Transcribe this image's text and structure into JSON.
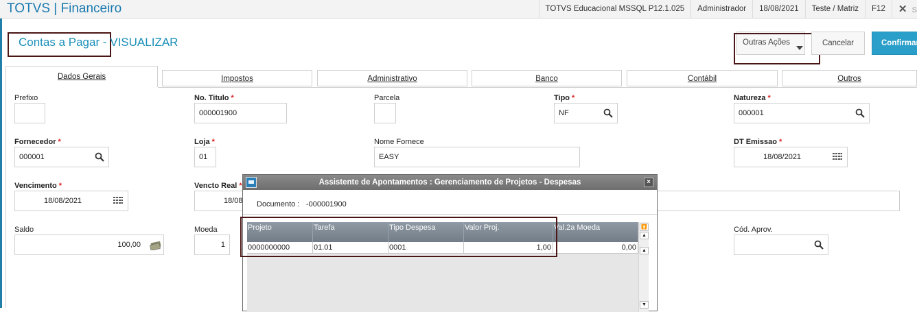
{
  "app": {
    "title": "TOTVS | Financeiro",
    "product": "TOTVS Educacional MSSQL P12.1.025",
    "user": "Administrador",
    "date": "18/08/2021",
    "company": "Teste / Matriz",
    "help_key": "F12",
    "exit_label": "S",
    "accent_color": "#1a7ab0"
  },
  "page": {
    "title": "Contas a Pagar",
    "separator": " - ",
    "mode": "VISUALIZAR"
  },
  "actions": {
    "other_actions": "Outras Ações",
    "cancel": "Cancelar",
    "confirm": "Confirmar"
  },
  "tabs": [
    "Dados Gerais",
    "Impostos",
    "Administrativo",
    "Banco",
    "Contábil",
    "Outros"
  ],
  "form": {
    "prefixo": {
      "label": "Prefixo",
      "value": ""
    },
    "no_titulo": {
      "label": "No. Titulo",
      "value": "000001900"
    },
    "parcela": {
      "label": "Parcela",
      "value": ""
    },
    "tipo": {
      "label": "Tipo",
      "value": "NF"
    },
    "natureza": {
      "label": "Natureza",
      "value": "000001"
    },
    "fornecedor": {
      "label": "Fornecedor",
      "value": "000001"
    },
    "loja": {
      "label": "Loja",
      "value": "01"
    },
    "nome_fornece": {
      "label": "Nome Fornece",
      "value": "EASY"
    },
    "dt_emissao": {
      "label": "DT Emissao",
      "value": "18/08/2021"
    },
    "vencimento": {
      "label": "Vencimento",
      "value": "18/08/2021"
    },
    "vencto_real": {
      "label": "Vencto Real",
      "value": "18/08"
    },
    "saldo": {
      "label": "Saldo",
      "value": "100,00"
    },
    "moeda": {
      "label": "Moeda",
      "value": "1"
    },
    "cod_aprov": {
      "label": "Cód. Aprov.",
      "value": ""
    },
    "required_mark": "*"
  },
  "dialog": {
    "title": "Assistente de Apontamentos : Gerenciamento de Projetos - Despesas",
    "doc_label": "Documento :",
    "doc_value": "-000001900",
    "close": "×",
    "columns": [
      "Projeto",
      "Tarefa",
      "Tipo Despesa",
      "Valor Proj.",
      "Val.2a Moeda"
    ],
    "rows": [
      [
        "0000000000",
        "01.01",
        "0001",
        "1,00",
        "0,00"
      ]
    ]
  }
}
